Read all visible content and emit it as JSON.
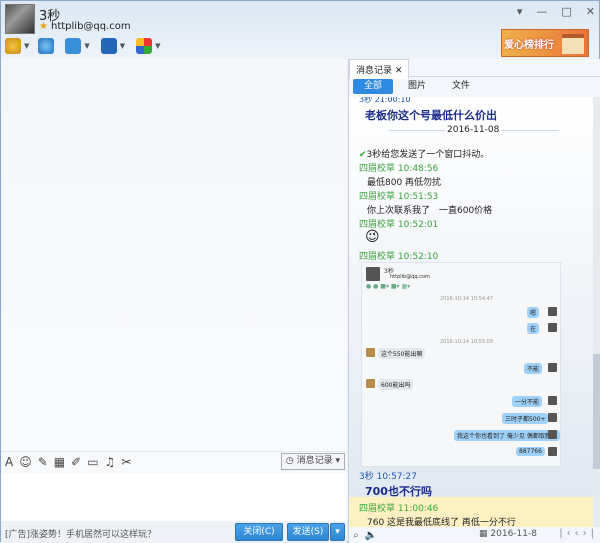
{
  "contact": {
    "name": "3秒",
    "email": "httplib@qq.com"
  },
  "footer": {
    "ad_text": "[广告]涨姿势！手机居然可以这样玩？",
    "close_label": "关闭(C)",
    "send_label": "发送(S)"
  },
  "history": {
    "tab_label": "消息记录",
    "tabs": [
      "全部",
      "图片",
      "文件"
    ],
    "partial_top": "3秒 21:00:10",
    "top_msg": "老板你这个号最低什么价出",
    "date_sep": "2016-11-08",
    "shake": "3秒给您发送了一个窗口抖动。",
    "msgs": [
      {
        "sender": "四眉校草 10:48:56",
        "text": "最低800 再低勿扰"
      },
      {
        "sender": "四眉校草 10:51:53",
        "text": "你上次联系我了　一直600价格"
      },
      {
        "sender": "四眉校草 10:52:01",
        "text": ""
      },
      {
        "sender": "四眉校草 10:52:10",
        "text": ""
      }
    ],
    "shot": {
      "name": "3秒",
      "email": "httplib@qq.com",
      "ts1": "2016-10-14 10:54:47",
      "ts2": "2016-10-14 10:55:09",
      "right_msgs": [
        "嗯",
        "在",
        "不能",
        "一分不能",
        "三时子都500+",
        "我这个你也看到了 俺少见 偶都取新的",
        "887766"
      ],
      "left_msgs": [
        "这个550能出嘛",
        "600能出吗"
      ]
    },
    "msg_3s_sender": "3秒 10:57:27",
    "msg_3s": "700也不行吗",
    "last_sender": "四眉校草 11:00:46",
    "last_text": "760 这是我最低底线了 再低一分不行",
    "date_label": "2016-11-8"
  },
  "toolbar": {
    "history_btn": "消息记录"
  }
}
